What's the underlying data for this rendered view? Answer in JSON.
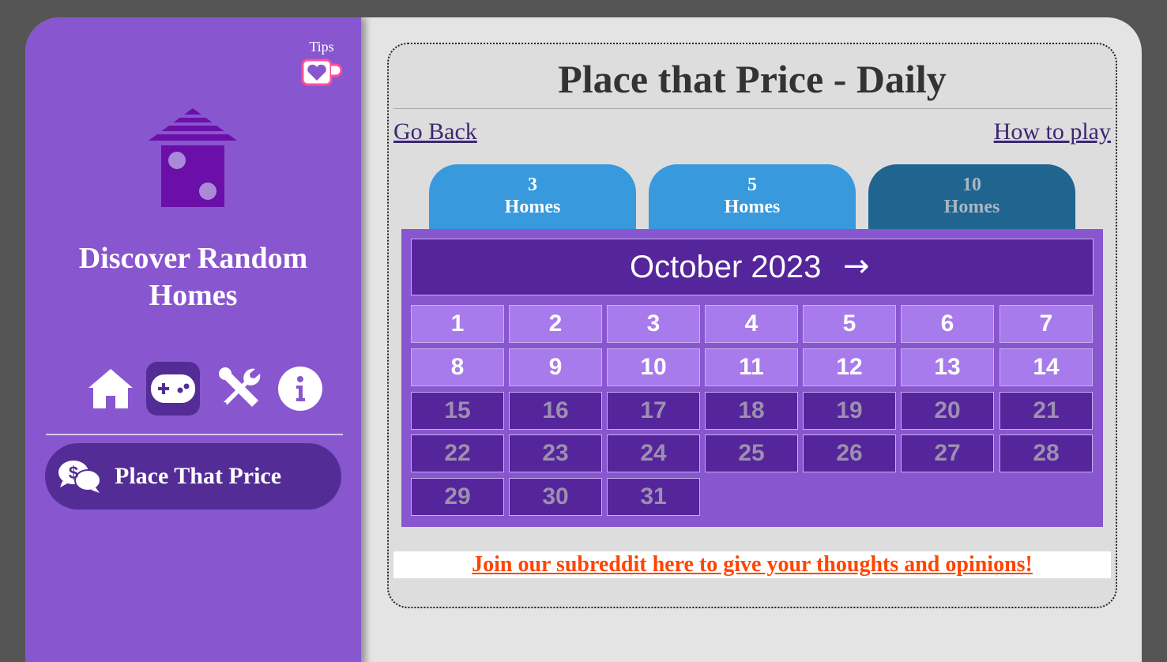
{
  "sidebar": {
    "tips_label": "Tips",
    "site_title": "Discover Random Homes",
    "nav": [
      {
        "name": "home-icon",
        "active": false
      },
      {
        "name": "gamepad-icon",
        "active": true
      },
      {
        "name": "tools-icon",
        "active": false
      },
      {
        "name": "info-icon",
        "active": false
      }
    ],
    "current_game": "Place That Price"
  },
  "main": {
    "title": "Place that Price - Daily",
    "go_back": "Go Back",
    "how_to_play": "How to play",
    "tabs": [
      {
        "count": "3",
        "label": "Homes",
        "selected": false
      },
      {
        "count": "5",
        "label": "Homes",
        "selected": false
      },
      {
        "count": "10",
        "label": "Homes",
        "selected": true
      }
    ],
    "calendar": {
      "month": "October 2023",
      "next_arrow": "→",
      "days": [
        "1",
        "2",
        "3",
        "4",
        "5",
        "6",
        "7",
        "8",
        "9",
        "10",
        "11",
        "12",
        "13",
        "14",
        "15",
        "16",
        "17",
        "18",
        "19",
        "20",
        "21",
        "22",
        "23",
        "24",
        "25",
        "26",
        "27",
        "28",
        "29",
        "30",
        "31"
      ],
      "available_through": 14
    },
    "reddit_link": "Join our subreddit here to give your thoughts and opinions!"
  },
  "colors": {
    "sidebar_bg": "#8856cf",
    "accent_dark": "#55259b",
    "day_available": "#a87bec",
    "tab_light": "#3899dc",
    "tab_dark": "#206490",
    "reddit_orange": "#ff4500"
  }
}
